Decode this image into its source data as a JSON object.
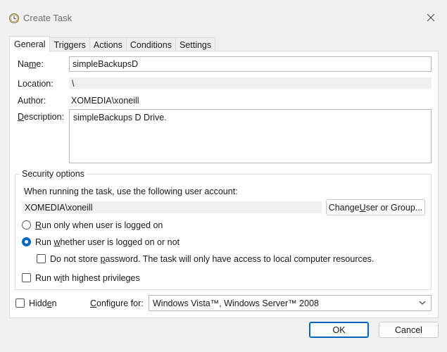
{
  "window": {
    "title": "Create Task",
    "icon": "task-scheduler-clock-icon",
    "close_icon": "close-icon"
  },
  "tabs": [
    {
      "label": "General",
      "active": true
    },
    {
      "label": "Triggers",
      "active": false
    },
    {
      "label": "Actions",
      "active": false
    },
    {
      "label": "Conditions",
      "active": false
    },
    {
      "label": "Settings",
      "active": false
    }
  ],
  "general": {
    "name_label_pre": "Na",
    "name_label_u": "m",
    "name_label_post": "e:",
    "name_value": "simpleBackupsD",
    "location_label": "Location:",
    "location_value": "\\",
    "author_label": "Author:",
    "author_value": "XOMEDIA\\xoneill",
    "description_label_u": "D",
    "description_label_post": "escription:",
    "description_value": "simpleBackups D Drive."
  },
  "security": {
    "group_title": "Security options",
    "account_prompt": "When running the task, use the following user account:",
    "account_value": "XOMEDIA\\xoneill",
    "change_button_pre": "Change ",
    "change_button_u": "U",
    "change_button_post": "ser or Group...",
    "run_logged_on_u": "R",
    "run_logged_on_post": "un only when user is logged on",
    "run_logged_on_checked": false,
    "run_whether_pre": "Run ",
    "run_whether_u": "w",
    "run_whether_post": "hether user is logged on or not",
    "run_whether_checked": true,
    "no_store_password_pre": "Do not store ",
    "no_store_password_u": "p",
    "no_store_password_post": "assword.  The task will only have access to local computer resources.",
    "no_store_password_checked": false,
    "highest_priv_pre": "Run w",
    "highest_priv_u": "i",
    "highest_priv_post": "th highest privileges",
    "highest_priv_checked": false
  },
  "bottom": {
    "hidden_pre": "Hidd",
    "hidden_u": "e",
    "hidden_post": "n",
    "hidden_checked": false,
    "configure_pre": "",
    "configure_u": "C",
    "configure_post": "onfigure for:",
    "configure_value": "Windows Vista™, Windows Server™ 2008"
  },
  "buttons": {
    "ok": "OK",
    "cancel": "Cancel"
  },
  "colors": {
    "accent": "#0067c0",
    "background": "#f0f0f0",
    "panel": "#ffffff"
  }
}
